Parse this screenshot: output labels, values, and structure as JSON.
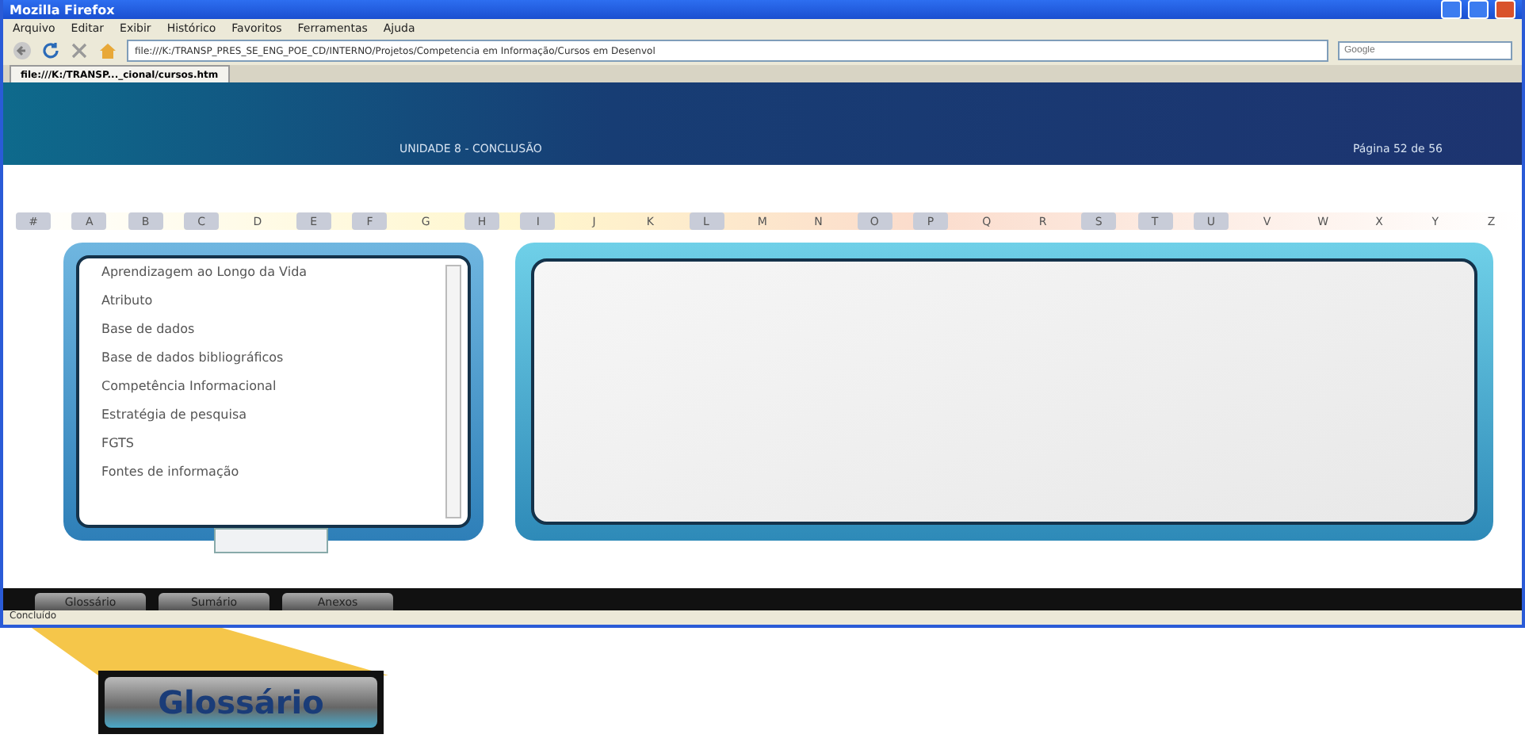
{
  "window": {
    "title": "Mozilla Firefox"
  },
  "menu": [
    "Arquivo",
    "Editar",
    "Exibir",
    "Histórico",
    "Favoritos",
    "Ferramentas",
    "Ajuda"
  ],
  "address": {
    "value": "file:///K:/TRANSP_PRES_SE_ENG_POE_CD/INTERNO/Projetos/Competencia em Informação/Cursos em Desenvol"
  },
  "search": {
    "placeholder": "Google"
  },
  "tab": {
    "label": "file:///K:/TRANSP..._cional/cursos.htm"
  },
  "header": {
    "unit": "UNIDADE 8 - CONCLUSÃO",
    "page": "Página 52 de 56"
  },
  "letters": [
    {
      "label": "#",
      "selected": true
    },
    {
      "label": "A",
      "selected": true
    },
    {
      "label": "B",
      "selected": true
    },
    {
      "label": "C",
      "selected": true
    },
    {
      "label": "D",
      "selected": false
    },
    {
      "label": "E",
      "selected": true
    },
    {
      "label": "F",
      "selected": true
    },
    {
      "label": "G",
      "selected": false
    },
    {
      "label": "H",
      "selected": true
    },
    {
      "label": "I",
      "selected": true
    },
    {
      "label": "J",
      "selected": false
    },
    {
      "label": "K",
      "selected": false
    },
    {
      "label": "L",
      "selected": true
    },
    {
      "label": "M",
      "selected": false
    },
    {
      "label": "N",
      "selected": false
    },
    {
      "label": "O",
      "selected": true
    },
    {
      "label": "P",
      "selected": true
    },
    {
      "label": "Q",
      "selected": false
    },
    {
      "label": "R",
      "selected": false
    },
    {
      "label": "S",
      "selected": true
    },
    {
      "label": "T",
      "selected": true
    },
    {
      "label": "U",
      "selected": true
    },
    {
      "label": "V",
      "selected": false
    },
    {
      "label": "W",
      "selected": false
    },
    {
      "label": "X",
      "selected": false
    },
    {
      "label": "Y",
      "selected": false
    },
    {
      "label": "Z",
      "selected": false
    }
  ],
  "terms": [
    "Aprendizagem ao Longo da Vida",
    "Atributo",
    "Base de dados",
    "Base de dados bibliográficos",
    "Competência Informacional",
    "Estratégia de pesquisa",
    "FGTS",
    "Fontes de informação"
  ],
  "bottom_tabs": [
    "Glossário",
    "Sumário",
    "Anexos"
  ],
  "status_bar": "Concluído",
  "callout": {
    "label": "Glossário"
  }
}
